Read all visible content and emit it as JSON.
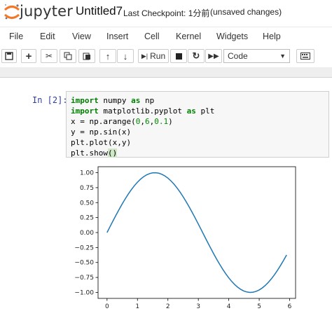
{
  "header": {
    "logo_text": "jupyter",
    "notebook_title": "Untitled7",
    "checkpoint_text": "Last Checkpoint: 1分前",
    "unsaved_text": "(unsaved changes)"
  },
  "menu": [
    "File",
    "Edit",
    "View",
    "Insert",
    "Cell",
    "Kernel",
    "Widgets",
    "Help"
  ],
  "toolbar": {
    "run_label": "Run",
    "cell_type": "Code",
    "icons": [
      "save-icon",
      "add-cell-icon",
      "cut-icon",
      "copy-icon",
      "paste-icon",
      "move-up-icon",
      "move-down-icon",
      "run-icon",
      "stop-icon",
      "restart-icon",
      "fast-forward-icon",
      "keyboard-icon"
    ]
  },
  "cell": {
    "prompt": "In [2]:",
    "code_lines": [
      "import numpy as np",
      "import matplotlib.pyplot as plt",
      "x = np.arange(0,6,0.1)",
      "y = np.sin(x)",
      "plt.plot(x,y)",
      "plt.show()"
    ]
  },
  "chart_data": {
    "type": "line",
    "series": [
      {
        "color": "#1f77b4",
        "function": "sin(x)",
        "x_start": 0,
        "x_stop": 6,
        "x_step": 0.1
      }
    ],
    "xticks": [
      "0",
      "1",
      "2",
      "3",
      "4",
      "5",
      "6"
    ],
    "yticks": [
      "1.00",
      "0.75",
      "0.50",
      "0.25",
      "0.00",
      "−0.25",
      "−0.50",
      "−0.75",
      "−1.00"
    ],
    "xlim": [
      -0.295,
      6.195
    ],
    "ylim": [
      -1.1,
      1.1
    ],
    "grid": false
  }
}
